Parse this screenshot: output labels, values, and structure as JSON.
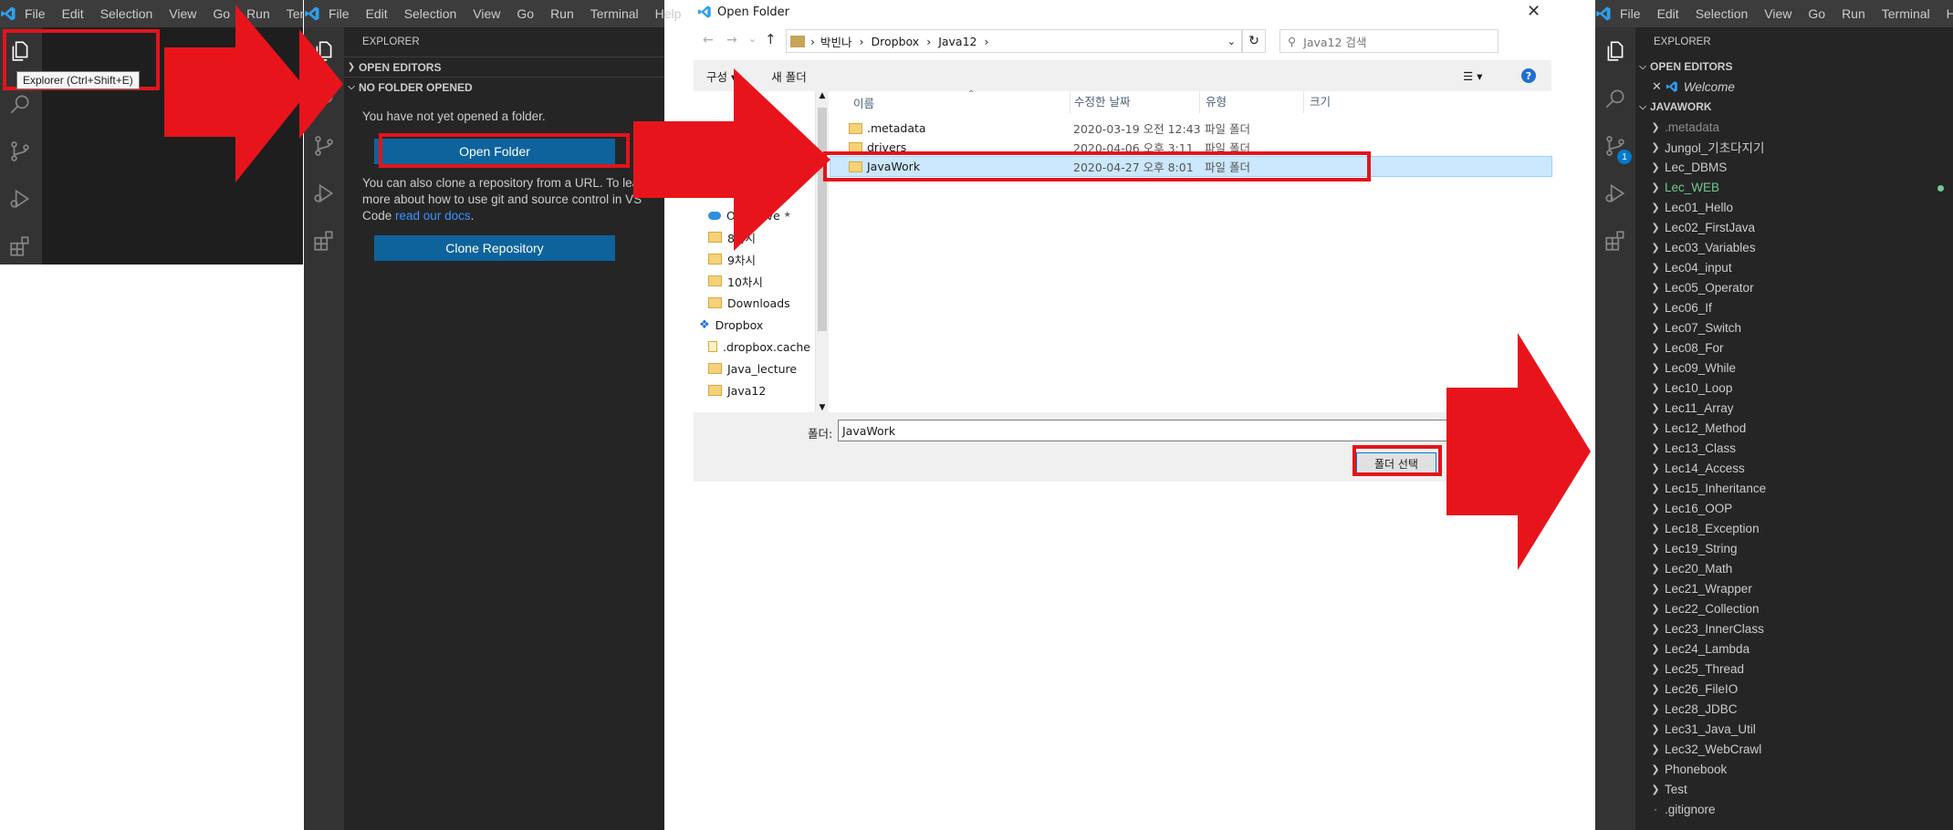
{
  "panel1": {
    "menu": [
      "File",
      "Edit",
      "Selection",
      "View",
      "Go",
      "Run",
      "Termi"
    ],
    "tooltip": "Explorer (Ctrl+Shift+E)"
  },
  "panel2": {
    "menu": [
      "File",
      "Edit",
      "Selection",
      "View",
      "Go",
      "Run",
      "Terminal",
      "Help"
    ],
    "explorer_title": "EXPLORER",
    "open_editors": "OPEN EDITORS",
    "no_folder": "NO FOLDER OPENED",
    "msg1": "You have not yet opened a folder.",
    "open_folder_btn": "Open Folder",
    "msg2_part1": "You can also clone a repository from a URL. To learn more about how to use git and source control in VS Code ",
    "msg2_link": "read our docs",
    "msg2_end": ".",
    "clone_btn": "Clone Repository"
  },
  "dialog": {
    "title": "Open Folder",
    "breadcrumb": [
      "박빈나",
      "Dropbox",
      "Java12"
    ],
    "search_placeholder": "Java12 검색",
    "organize": "구성",
    "new_folder": "새 폴더",
    "columns": [
      "이름",
      "수정한 날짜",
      "유형",
      "크기"
    ],
    "nav": [
      {
        "label": "OneDrive",
        "type": "onedrive",
        "pinned": true
      },
      {
        "label": "8차시",
        "type": "folder"
      },
      {
        "label": "9차시",
        "type": "folder"
      },
      {
        "label": "10차시",
        "type": "folder"
      },
      {
        "label": "Downloads",
        "type": "folder"
      },
      {
        "label": "Dropbox",
        "type": "dropbox"
      },
      {
        "label": ".dropbox.cache",
        "type": "folder-light"
      },
      {
        "label": "Java_lecture",
        "type": "folder"
      },
      {
        "label": "Java12",
        "type": "folder"
      }
    ],
    "files": [
      {
        "name": ".metadata",
        "date": "2020-03-19 오전 12:43",
        "type": "파일 폴더"
      },
      {
        "name": "drivers",
        "date": "2020-04-06 오후 3:11",
        "type": "파일 폴더"
      },
      {
        "name": "JavaWork",
        "date": "2020-04-27 오후 8:01",
        "type": "파일 폴더"
      }
    ],
    "folder_label": "폴더:",
    "folder_value": "JavaWork",
    "select_btn": "폴더 선택"
  },
  "panel4": {
    "menu": [
      "File",
      "Edit",
      "Selection",
      "View",
      "Go",
      "Run",
      "Terminal",
      "Help"
    ],
    "explorer_title": "EXPLORER",
    "open_editors": "OPEN EDITORS",
    "editor_item": "Welcome",
    "workspace": "JAVAWORK",
    "scm_badge": "1",
    "folders": [
      ".metadata",
      "Jungol_기초다지기",
      "Lec_DBMS",
      "Lec_WEB",
      "Lec01_Hello",
      "Lec02_FirstJava",
      "Lec03_Variables",
      "Lec04_input",
      "Lec05_Operator",
      "Lec06_If",
      "Lec07_Switch",
      "Lec08_For",
      "Lec09_While",
      "Lec10_Loop",
      "Lec11_Array",
      "Lec12_Method",
      "Lec13_Class",
      "Lec14_Access",
      "Lec15_Inheritance",
      "Lec16_OOP",
      "Lec18_Exception",
      "Lec19_String",
      "Lec20_Math",
      "Lec21_Wrapper",
      "Lec22_Collection",
      "Lec23_InnerClass",
      "Lec24_Lambda",
      "Lec25_Thread",
      "Lec26_FileIO",
      "Lec28_JDBC",
      "Lec31_Java_Util",
      "Lec32_WebCrawl",
      "Phonebook",
      "Test"
    ],
    "files": [
      ".gitignore"
    ],
    "colors": {
      "modified": "#73c991",
      "ignored": "#8c8c8c"
    }
  }
}
